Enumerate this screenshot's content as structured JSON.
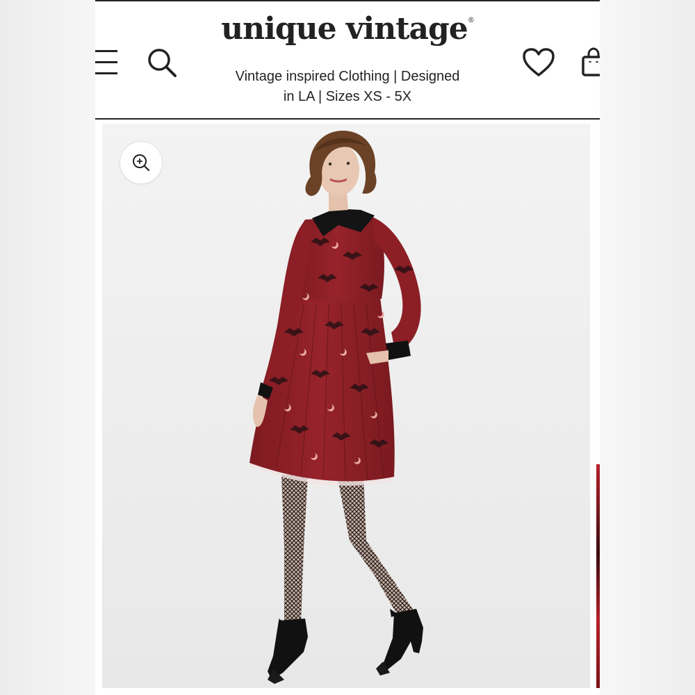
{
  "header": {
    "logo_text": "unique vintage",
    "logo_mark": "®",
    "tagline_line1": "Vintage inspired Clothing | Designed",
    "tagline_line2": "in LA | Sizes XS - 5X"
  },
  "icons": {
    "menu": "hamburger-menu-icon",
    "search": "search-icon",
    "wishlist": "heart-icon",
    "cart": "shopping-bag-icon",
    "zoom": "zoom-in-icon"
  },
  "colors": {
    "text": "#222222",
    "dress_red": "#8e1f26",
    "collar_black": "#111111",
    "background": "#ffffff"
  }
}
